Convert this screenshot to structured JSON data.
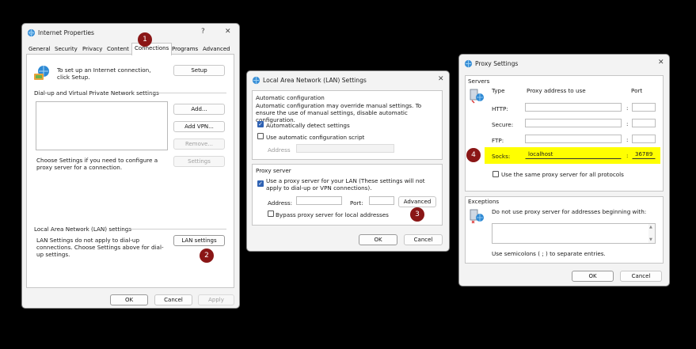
{
  "internet_properties": {
    "title": "Internet Properties",
    "help": "?",
    "close": "✕",
    "tabs": [
      "General",
      "Security",
      "Privacy",
      "Content",
      "Connections",
      "Programs",
      "Advanced"
    ],
    "setup_text": "To set up an Internet connection, click Setup.",
    "setup_button": "Setup",
    "dialup_header": "Dial-up and Virtual Private Network settings",
    "add_button": "Add...",
    "add_vpn_button": "Add VPN...",
    "remove_button": "Remove...",
    "settings_button": "Settings",
    "proxy_hint": "Choose Settings if you need to configure a proxy server for a connection.",
    "lan_header": "Local Area Network (LAN) settings",
    "lan_text": "LAN Settings do not apply to dial-up connections. Choose Settings above for dial-up settings.",
    "lan_settings_button": "LAN settings",
    "ok": "OK",
    "cancel": "Cancel",
    "apply": "Apply"
  },
  "lan_settings": {
    "title": "Local Area Network (LAN) Settings",
    "close": "✕",
    "auto_header": "Automatic configuration",
    "auto_text": "Automatic configuration may override manual settings.  To ensure the use of manual settings, disable automatic configuration.",
    "auto_detect": "Automatically detect settings",
    "use_script": "Use automatic configuration script",
    "address_label": "Address",
    "proxy_header": "Proxy server",
    "use_proxy": "Use a proxy server for your LAN (These settings will not apply to dial-up or VPN connections).",
    "address2_label": "Address:",
    "port_label": "Port:",
    "advanced_button": "Advanced",
    "bypass": "Bypass proxy server for local addresses",
    "ok": "OK",
    "cancel": "Cancel"
  },
  "proxy_settings": {
    "title": "Proxy Settings",
    "close": "✕",
    "servers_header": "Servers",
    "col_type": "Type",
    "col_address": "Proxy address to use",
    "col_port": "Port",
    "rows": [
      {
        "label": "HTTP:",
        "address": "",
        "port": ""
      },
      {
        "label": "Secure:",
        "address": "",
        "port": ""
      },
      {
        "label": "FTP:",
        "address": "",
        "port": ""
      },
      {
        "label": "Socks:",
        "address": "localhost",
        "port": "36789"
      }
    ],
    "colon": ":",
    "same_proxy": "Use the same proxy server for all protocols",
    "exceptions_header": "Exceptions",
    "exceptions_text": "Do not use proxy server for addresses beginning with:",
    "semicolons_text": "Use semicolons ( ; ) to separate entries.",
    "ok": "OK",
    "cancel": "Cancel"
  },
  "badges": [
    "1",
    "2",
    "3",
    "4"
  ],
  "colors": {
    "badge": "#8a1616",
    "highlight": "#ffff00",
    "checkbox": "#2f62b3"
  }
}
